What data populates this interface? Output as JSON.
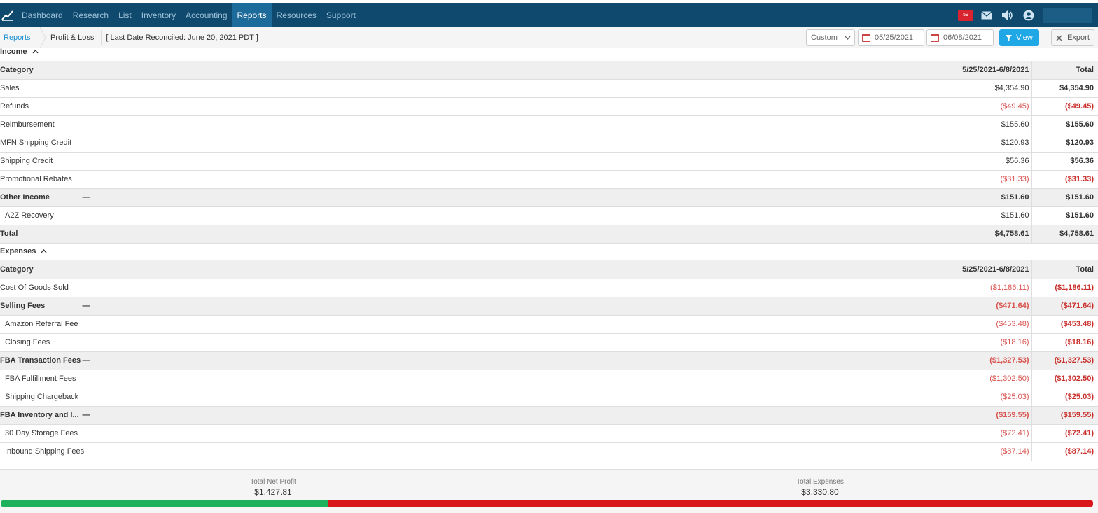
{
  "nav": {
    "items": [
      "Dashboard",
      "Research",
      "List",
      "Inventory",
      "Accounting",
      "Reports",
      "Resources",
      "Support"
    ],
    "active": "Reports",
    "notification_count": "59"
  },
  "breadcrumb": {
    "root": "Reports",
    "current": "Profit & Loss",
    "reconciled": "[ Last Date Reconciled: June 20, 2021 PDT ]"
  },
  "controls": {
    "range": "Custom",
    "start_date": "05/25/2021",
    "end_date": "06/08/2021",
    "view_label": "View",
    "export_label": "Export"
  },
  "income": {
    "title": "Income",
    "headers": {
      "category": "Category",
      "period": "5/25/2021-6/8/2021",
      "total": "Total"
    },
    "rows": [
      {
        "type": "row",
        "label": "Sales",
        "period": "$4,354.90",
        "total": "$4,354.90",
        "neg": false
      },
      {
        "type": "row",
        "label": "Refunds",
        "period": "($49.45)",
        "total": "($49.45)",
        "neg": true
      },
      {
        "type": "row",
        "label": "Reimbursement",
        "period": "$155.60",
        "total": "$155.60",
        "neg": false
      },
      {
        "type": "row",
        "label": "MFN Shipping Credit",
        "period": "$120.93",
        "total": "$120.93",
        "neg": false
      },
      {
        "type": "row",
        "label": "Shipping Credit",
        "period": "$56.36",
        "total": "$56.36",
        "neg": false
      },
      {
        "type": "row",
        "label": "Promotional Rebates",
        "period": "($31.33)",
        "total": "($31.33)",
        "neg": true
      },
      {
        "type": "group",
        "label": "Other Income",
        "period": "$151.60",
        "total": "$151.60",
        "neg": false
      },
      {
        "type": "child",
        "label": "A2Z Recovery",
        "period": "$151.60",
        "total": "$151.60",
        "neg": false
      },
      {
        "type": "total",
        "label": "Total",
        "period": "$4,758.61",
        "total": "$4,758.61",
        "neg": false
      }
    ]
  },
  "expenses": {
    "title": "Expenses",
    "headers": {
      "category": "Category",
      "period": "5/25/2021-6/8/2021",
      "total": "Total"
    },
    "rows": [
      {
        "type": "row",
        "label": "Cost Of Goods Sold",
        "period": "($1,186.11)",
        "total": "($1,186.11)",
        "neg": true
      },
      {
        "type": "group",
        "label": "Selling Fees",
        "period": "($471.64)",
        "total": "($471.64)",
        "neg": true
      },
      {
        "type": "child",
        "label": "Amazon Referral Fee",
        "period": "($453.48)",
        "total": "($453.48)",
        "neg": true
      },
      {
        "type": "child",
        "label": "Closing Fees",
        "period": "($18.16)",
        "total": "($18.16)",
        "neg": true
      },
      {
        "type": "group",
        "label": "FBA Transaction Fees",
        "period": "($1,327.53)",
        "total": "($1,327.53)",
        "neg": true
      },
      {
        "type": "child",
        "label": "FBA Fulfillment Fees",
        "period": "($1,302.50)",
        "total": "($1,302.50)",
        "neg": true
      },
      {
        "type": "child",
        "label": "Shipping Chargeback",
        "period": "($25.03)",
        "total": "($25.03)",
        "neg": true
      },
      {
        "type": "group",
        "label": "FBA Inventory and I...",
        "period": "($159.55)",
        "total": "($159.55)",
        "neg": true
      },
      {
        "type": "child",
        "label": "30 Day Storage Fees",
        "period": "($72.41)",
        "total": "($72.41)",
        "neg": true
      },
      {
        "type": "child",
        "label": "Inbound Shipping Fees",
        "period": "($87.14)",
        "total": "($87.14)",
        "neg": true
      }
    ]
  },
  "footer": {
    "net_profit_label": "Total Net Profit",
    "net_profit_value": "$1,427.81",
    "expenses_label": "Total Expenses",
    "expenses_value": "$3,330.80",
    "profit_share": 0.3
  },
  "colors": {
    "nav_bg": "#0f4a6e",
    "accent": "#20a8e6",
    "negative": "#d9534f",
    "profit_bar": "#1cb15a",
    "expense_bar": "#d9161c"
  }
}
